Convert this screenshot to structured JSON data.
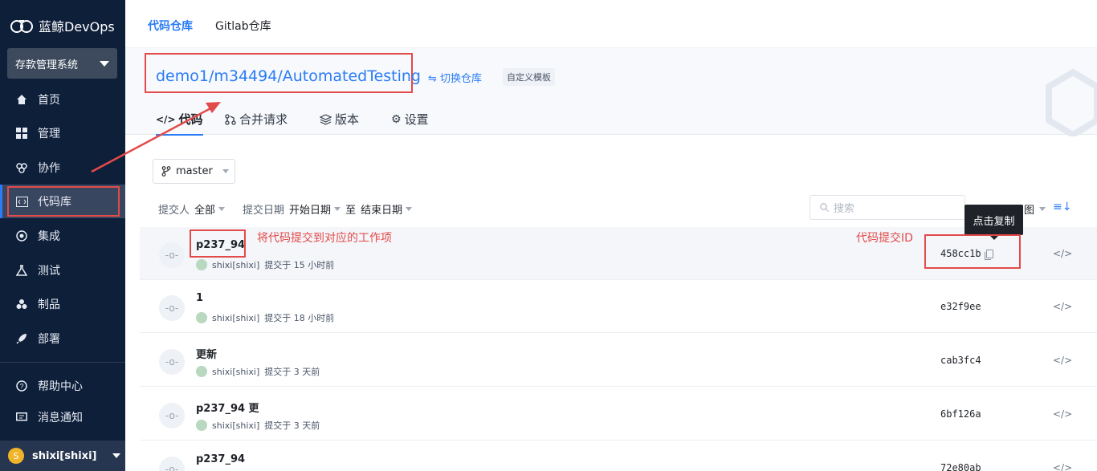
{
  "app": {
    "logo_text": "蓝鲸DevOps",
    "project_select": "存款管理系统"
  },
  "sidebar": {
    "items": [
      {
        "label": "首页",
        "icon": "home-icon"
      },
      {
        "label": "管理",
        "icon": "grid-icon"
      },
      {
        "label": "协作",
        "icon": "collab-icon"
      },
      {
        "label": "代码库",
        "icon": "repo-icon",
        "active": true
      },
      {
        "label": "集成",
        "icon": "integration-icon"
      },
      {
        "label": "测试",
        "icon": "flask-icon"
      },
      {
        "label": "制品",
        "icon": "artifact-icon"
      },
      {
        "label": "部署",
        "icon": "rocket-icon"
      }
    ],
    "help": "帮助中心",
    "messages": "消息通知",
    "user": {
      "avatar_letter": "S",
      "name": "shixi[shixi]"
    }
  },
  "top_tabs": [
    {
      "label": "代码仓库",
      "active": true
    },
    {
      "label": "Gitlab仓库",
      "active": false
    }
  ],
  "repo": {
    "path": "demo1/m34494/AutomatedTesting",
    "switch_label": "⇋ 切换仓库",
    "template_badge": "自定义模板",
    "tabs": [
      {
        "label": "代码",
        "icon": "code-icon",
        "active": true
      },
      {
        "label": "合并请求",
        "icon": "merge-request-icon",
        "active": false
      },
      {
        "label": "版本",
        "icon": "tag-icon",
        "active": false
      },
      {
        "label": "设置",
        "icon": "gear-icon",
        "active": false
      }
    ]
  },
  "filters": {
    "branch": "master",
    "committer_label": "提交人",
    "committer_value": "全部",
    "date_label": "提交日期",
    "start_date": "开始日期",
    "to_label": "至",
    "end_date": "结束日期",
    "search_placeholder": "搜索",
    "view_label": "图"
  },
  "tooltip": "点击复制",
  "annotations": {
    "commit_note": "将代码提交到对应的工作项",
    "id_note": "代码提交ID"
  },
  "commits": [
    {
      "title": "p237_94",
      "author": "shixi[shixi]",
      "time": "提交于 15 小时前",
      "sha": "458cc1b"
    },
    {
      "title": "1",
      "author": "shixi[shixi]",
      "time": "提交于 18 小时前",
      "sha": "e32f9ee"
    },
    {
      "title": "更新",
      "author": "shixi[shixi]",
      "time": "提交于 3 天前",
      "sha": "cab3fc4"
    },
    {
      "title": "p237_94 更",
      "author": "shixi[shixi]",
      "time": "提交于 3 天前",
      "sha": "6bf126a"
    },
    {
      "title": "p237_94",
      "author": "",
      "time": "",
      "sha": "72e80ab"
    }
  ],
  "colors": {
    "sidebar_bg": "#0e1f3a",
    "accent": "#2b7cf6",
    "annotation_red": "#e34a4a"
  }
}
